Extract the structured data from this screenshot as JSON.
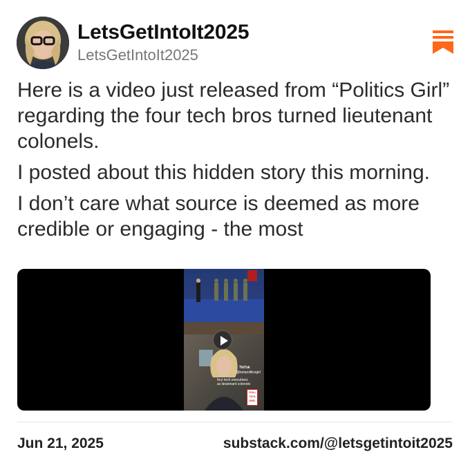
{
  "author": {
    "name": "LetsGetIntoIt2025",
    "handle": "LetsGetIntoIt2025"
  },
  "post": {
    "paragraphs": [
      "Here is a video just released from “Politics Girl” regarding the four tech bros turned lieutenant colonels.",
      "I posted about this hidden story this morning.",
      "I don’t care what source is deemed as more credible or engaging - the most"
    ]
  },
  "video": {
    "tiktok_label": "TikTok",
    "tiktok_handle": "@iampoliticsgirl",
    "caption": "four tech executives as lieutenant colonels",
    "badge": "POLI TICS GIRL"
  },
  "footer": {
    "date": "Jun 21, 2025",
    "url": "substack.com/@letsgetintoit2025"
  },
  "colors": {
    "accent": "#FF6719",
    "text": "#2b2b2b",
    "muted": "#777777"
  }
}
